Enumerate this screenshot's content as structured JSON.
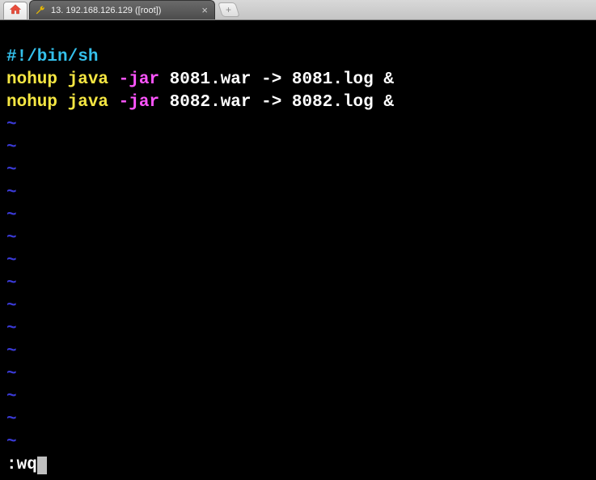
{
  "tab": {
    "title": "13. 192.168.126.129 ([root])"
  },
  "editor": {
    "shebang": "#!/bin/sh",
    "lines": [
      {
        "nohup": "nohup",
        "java": "java",
        "jar": "-jar",
        "rest": " 8081.war -> 8081.log &"
      },
      {
        "nohup": "nohup",
        "java": "java",
        "jar": "-jar",
        "rest": " 8082.war -> 8082.log &"
      }
    ],
    "tilde": "~",
    "command": ":wq"
  }
}
